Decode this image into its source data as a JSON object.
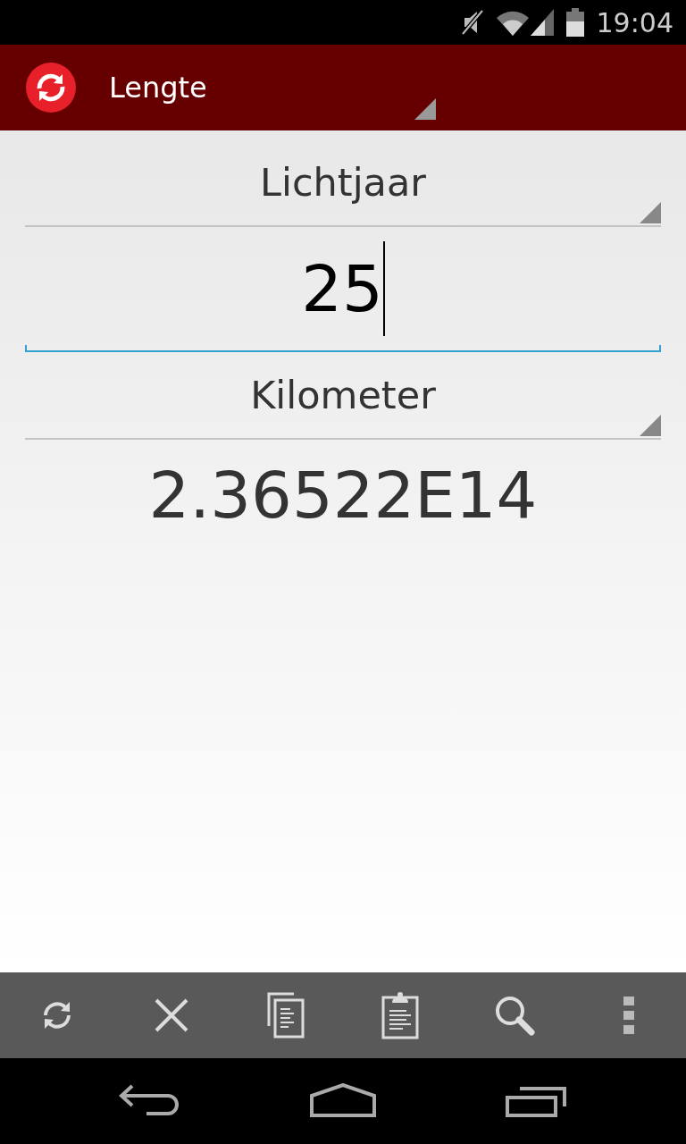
{
  "status_bar": {
    "time": "19:04"
  },
  "action_bar": {
    "title": "Lengte"
  },
  "from_unit": {
    "label": "Lichtjaar"
  },
  "input": {
    "value": "25"
  },
  "to_unit": {
    "label": "Kilometer"
  },
  "result": {
    "value": "2.36522E14"
  }
}
